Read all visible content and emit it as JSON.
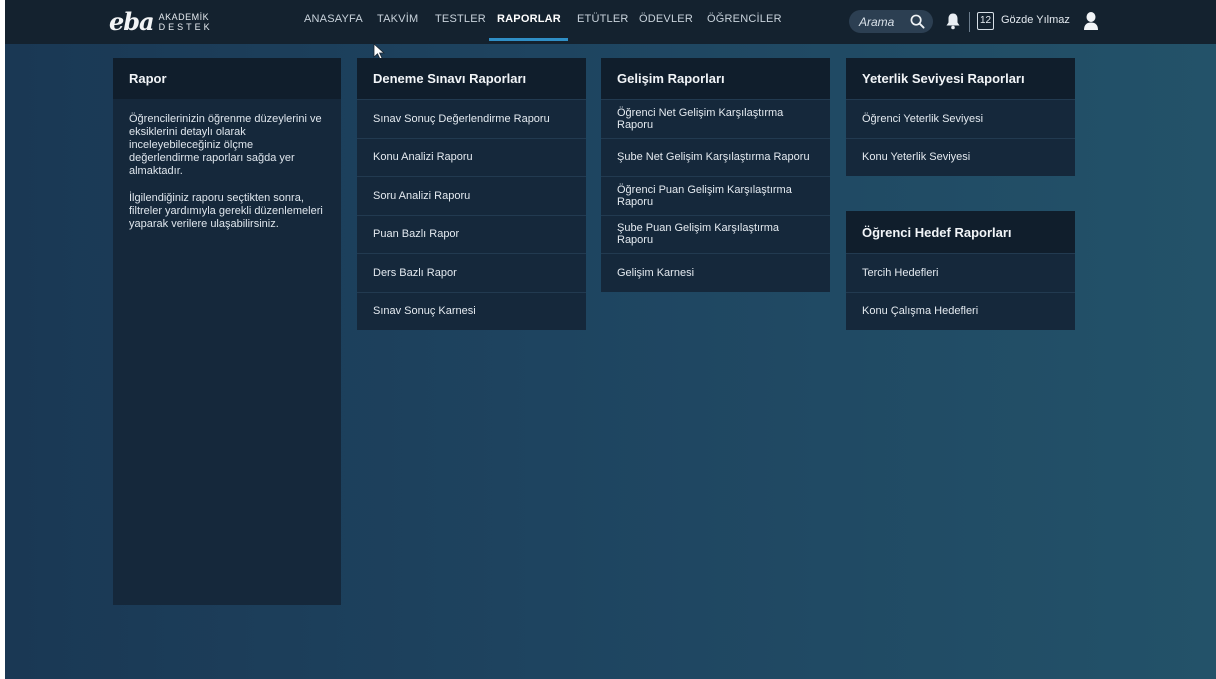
{
  "header": {
    "logo_mark": "eba",
    "logo_line1": "AKADEMİK",
    "logo_line2": "DESTEK",
    "nav": [
      {
        "label": "ANASAYFA"
      },
      {
        "label": "TAKVİM"
      },
      {
        "label": "TESTLER"
      },
      {
        "label": "RAPORLAR"
      },
      {
        "label": "ETÜTLER"
      },
      {
        "label": "ÖDEVLER"
      },
      {
        "label": "ÖĞRENCİLER"
      }
    ],
    "active_nav": "RAPORLAR",
    "search_placeholder": "Arama",
    "calendar_day": "12",
    "user_name": "Gözde Yılmaz"
  },
  "intro": {
    "title": "Rapor",
    "paragraph1": "Öğrencilerinizin öğrenme düzeylerini ve eksiklerini detaylı olarak inceleyebileceğiniz ölçme değerlendirme raporları sağda yer almaktadır.",
    "paragraph2": "İlgilendiğiniz raporu seçtikten sonra, filtreler yardımıyla gerekli düzenlemeleri yaparak verilere ulaşabilirsiniz."
  },
  "deneme": {
    "title": "Deneme Sınavı Raporları",
    "items": [
      "Sınav Sonuç Değerlendirme Raporu",
      "Konu Analizi Raporu",
      "Soru Analizi Raporu",
      "Puan Bazlı Rapor",
      "Ders Bazlı Rapor",
      "Sınav Sonuç Karnesi"
    ]
  },
  "gelisim": {
    "title": "Gelişim Raporları",
    "items": [
      "Öğrenci Net Gelişim Karşılaştırma Raporu",
      "Şube Net Gelişim Karşılaştırma Raporu",
      "Öğrenci Puan Gelişim Karşılaştırma Raporu",
      "Şube Puan Gelişim Karşılaştırma Raporu",
      "Gelişim Karnesi"
    ]
  },
  "yeterlik": {
    "title": "Yeterlik Seviyesi Raporları",
    "items": [
      "Öğrenci Yeterlik Seviyesi",
      "Konu Yeterlik Seviyesi"
    ]
  },
  "hedef": {
    "title": "Öğrenci Hedef Raporları",
    "items": [
      "Tercih Hedefleri",
      "Konu Çalışma Hedefleri"
    ]
  },
  "colors": {
    "accent": "#2f8fc6",
    "topbar": "#14222f",
    "panel": "#15283b",
    "panel_header": "#101e2c"
  }
}
